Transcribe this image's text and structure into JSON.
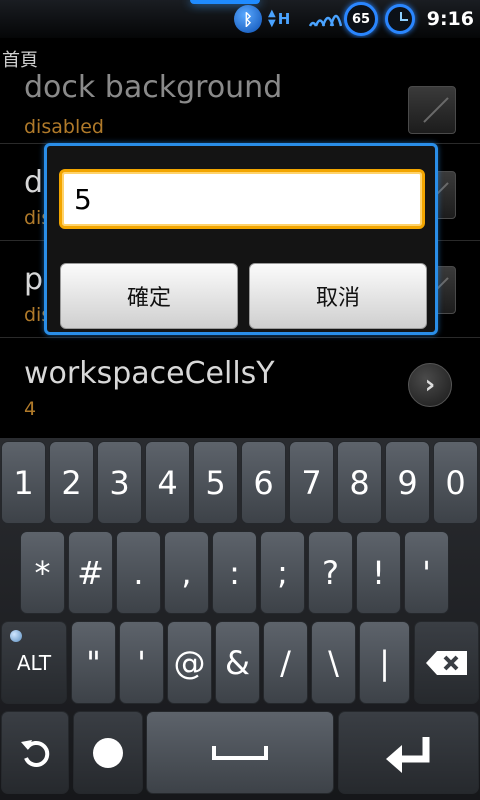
{
  "status_bar": {
    "bluetooth_icon": "bluetooth-icon",
    "data_type": "H",
    "battery_level": "65",
    "alarm_icon": "alarm-clock-icon",
    "time": "9:16"
  },
  "settings": {
    "section_header": "首頁",
    "rows": [
      {
        "title": "dock background",
        "summary": "disabled",
        "widget": "checkbox"
      },
      {
        "title": "d",
        "summary": "dis",
        "widget": "checkbox"
      },
      {
        "title": "pa",
        "summary": "dis",
        "widget": "checkbox"
      },
      {
        "title": "workspaceCellsY",
        "summary": "4",
        "widget": "chevron-right-icon"
      }
    ]
  },
  "dialog": {
    "input_value": "5",
    "ok_label": "確定",
    "cancel_label": "取消",
    "border_color": "#2a8ee8"
  },
  "keyboard": {
    "row1": [
      "1",
      "2",
      "3",
      "4",
      "5",
      "6",
      "7",
      "8",
      "9",
      "0"
    ],
    "row2": [
      "*",
      "#",
      ".",
      ",",
      ":",
      ";",
      "?",
      "!",
      "'"
    ],
    "row3": {
      "alt": "ALT",
      "keys": [
        "\"",
        "'",
        "@",
        "&",
        "/",
        "\\",
        "|"
      ],
      "backspace_icon": "backspace-icon"
    },
    "row4": {
      "undo_icon": "undo-icon",
      "dot_icon": "dot-icon",
      "space_icon": "space-icon",
      "enter_icon": "enter-icon"
    }
  }
}
